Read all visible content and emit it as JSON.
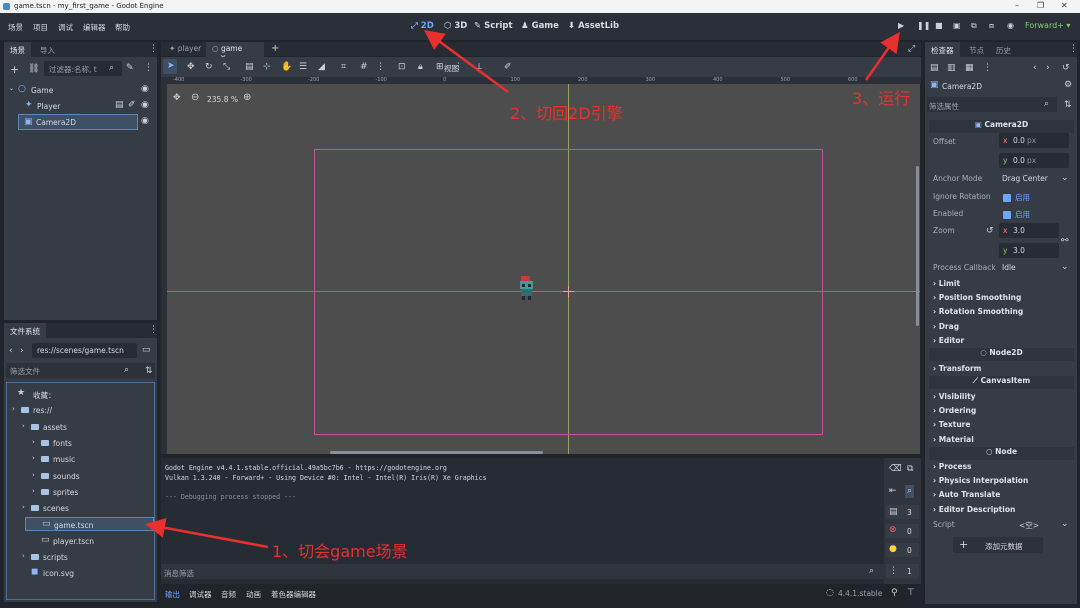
{
  "window": {
    "title": "game.tscn - my_first_game - Godot Engine"
  },
  "menu": [
    "场景",
    "项目",
    "调试",
    "编辑器",
    "帮助"
  ],
  "modes": [
    {
      "label": "2D",
      "active": true
    },
    {
      "label": "3D"
    },
    {
      "label": "Script"
    },
    {
      "label": "Game"
    },
    {
      "label": "AssetLib"
    }
  ],
  "renderer": "Forward+",
  "scene_dock": {
    "tabs": [
      "场景",
      "导入"
    ],
    "filter_placeholder": "过滤器:名称, t",
    "nodes": [
      {
        "name": "Game",
        "depth": 0
      },
      {
        "name": "Player",
        "depth": 1
      },
      {
        "name": "Camera2D",
        "depth": 1,
        "selected": true
      }
    ]
  },
  "filesystem": {
    "tab": "文件系统",
    "path": "res://scenes/game.tscn",
    "filter_placeholder": "筛选文件",
    "items": [
      {
        "label": "收藏：",
        "depth": 0,
        "kind": "star"
      },
      {
        "label": "res://",
        "depth": 0,
        "kind": "folder"
      },
      {
        "label": "assets",
        "depth": 1,
        "kind": "folder"
      },
      {
        "label": "fonts",
        "depth": 2,
        "kind": "folder"
      },
      {
        "label": "music",
        "depth": 2,
        "kind": "folder"
      },
      {
        "label": "sounds",
        "depth": 2,
        "kind": "folder"
      },
      {
        "label": "sprites",
        "depth": 2,
        "kind": "folder"
      },
      {
        "label": "scenes",
        "depth": 1,
        "kind": "folder"
      },
      {
        "label": "game.tscn",
        "depth": 2,
        "kind": "scene",
        "selected": true
      },
      {
        "label": "player.tscn",
        "depth": 2,
        "kind": "scene"
      },
      {
        "label": "scripts",
        "depth": 1,
        "kind": "folder"
      },
      {
        "label": "icon.svg",
        "depth": 1,
        "kind": "file"
      }
    ]
  },
  "editor_tabs": [
    {
      "label": "player"
    },
    {
      "label": "game",
      "active": true
    }
  ],
  "toolbar": {
    "view_label": "视图"
  },
  "viewport": {
    "zoom": "235.8 %"
  },
  "ruler": [
    "-400",
    "-300",
    "-200",
    "-100",
    "0",
    "100",
    "200",
    "300",
    "400",
    "500",
    "600"
  ],
  "output": {
    "lines": [
      "Godot Engine v4.4.1.stable.official.49a5bc7b6 - https://godotengine.org",
      "Vulkan 1.3.240 - Forward+ - Using Device #0: Intel - Intel(R) Iris(R) Xe Graphics",
      "",
      "--- Debugging process stopped ---"
    ],
    "filter_placeholder": "消息筛选",
    "counts": [
      "3",
      "0",
      "0",
      "1"
    ]
  },
  "bottom_tabs": [
    "输出",
    "调试器",
    "音频",
    "动画",
    "着色器编辑器"
  ],
  "version": "4.4.1.stable",
  "inspector": {
    "tabs": [
      "检查器",
      "节点",
      "历史"
    ],
    "node": "Camera2D",
    "filter_placeholder": "筛选属性",
    "class_header": "Camera2D",
    "offset": {
      "label": "Offset",
      "x": "0.0",
      "y": "0.0",
      "unit": "px"
    },
    "anchor_mode": {
      "label": "Anchor Mode",
      "value": "Drag Center"
    },
    "ignore_rotation": {
      "label": "Ignore Rotation",
      "value": "启用"
    },
    "enabled": {
      "label": "Enabled",
      "value": "启用"
    },
    "zoom": {
      "label": "Zoom",
      "x": "3.0",
      "y": "3.0"
    },
    "process_callback": {
      "label": "Process Callback",
      "value": "Idle"
    },
    "groups_camera": [
      "Limit",
      "Position Smoothing",
      "Rotation Smoothing",
      "Drag",
      "Editor"
    ],
    "node2d_header": "Node2D",
    "groups_node2d": [
      "Transform"
    ],
    "canvasitem_header": "CanvasItem",
    "groups_canvas": [
      "Visibility",
      "Ordering",
      "Texture",
      "Material"
    ],
    "node_header": "Node",
    "groups_node": [
      "Process",
      "Physics Interpolation",
      "Auto Translate",
      "Editor Description"
    ],
    "script_label": "Script",
    "script_value": "<空>",
    "add_meta": "添加元数据"
  },
  "annotations": [
    {
      "text": "1、切会game场景"
    },
    {
      "text": "2、切回2D引擎"
    },
    {
      "text": "3、运行"
    }
  ],
  "colors": {
    "accent": "#6ea6ff",
    "annotation": "#e8302f",
    "viewport_bg": "#4d4d4d",
    "camera_rect": "#c2549a"
  }
}
